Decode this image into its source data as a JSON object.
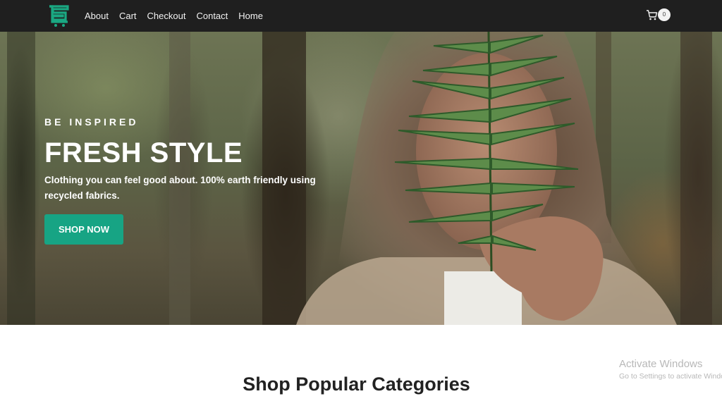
{
  "nav": {
    "logo": "e-commerce-cart-logo",
    "links": [
      {
        "label": "About"
      },
      {
        "label": "Cart"
      },
      {
        "label": "Checkout"
      },
      {
        "label": "Contact"
      },
      {
        "label": "Home"
      }
    ],
    "cart": {
      "icon": "shopping-cart-icon",
      "count": "0"
    }
  },
  "hero": {
    "eyebrow": "BE INSPIRED",
    "title": "FRESH STYLE",
    "subtitle": "Clothing you can feel good about. 100% earth friendly using recycled fabrics.",
    "cta_label": "SHOP NOW",
    "image": "woman-holding-fern-in-forest"
  },
  "section": {
    "title": "Shop Popular Categories"
  },
  "watermark": {
    "title": "Activate Windows",
    "subtitle": "Go to Settings to activate Windows."
  },
  "colors": {
    "accent": "#17a484",
    "navbar_bg": "#1f1f1f",
    "heading_text": "#222222"
  }
}
